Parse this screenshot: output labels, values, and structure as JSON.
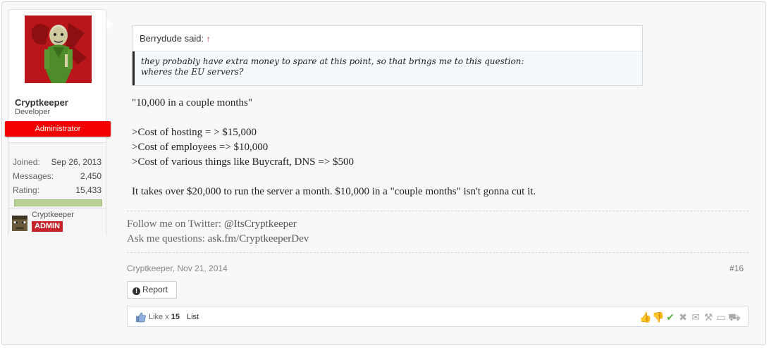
{
  "user": {
    "name": "Cryptkeeper",
    "title": "Developer",
    "banner": "Administrator",
    "joined_label": "Joined:",
    "joined_value": "Sep 26, 2013",
    "messages_label": "Messages:",
    "messages_value": "2,450",
    "rating_label": "Rating:",
    "rating_value": "15,433",
    "rating_bar_fraction": 1.0,
    "secondary_name": "Cryptkeeper",
    "badge": "ADMIN"
  },
  "quote": {
    "author": "Berrydude said:",
    "arrow": "↑",
    "line1": "they probably have extra money to spare at this point, so that brings me to this question:",
    "line2": "wheres the EU servers?"
  },
  "message": {
    "line1": "\"10,000 in a couple months\"",
    "line2": ">Cost of hosting = > $15,000",
    "line3": ">Cost of employees => $10,000",
    "line4": ">Cost of various things like Buycraft, DNS => $500",
    "line5": "It takes over $20,000 to run the server a month. $10,000 in a \"couple months\" isn't gonna cut it."
  },
  "signature": {
    "line1_prefix": "Follow me on Twitter: ",
    "line1_handle": "@ItsCryptkeeper",
    "line2_prefix": "Ask me questions: ",
    "line2_link": "ask.fm/CryptkeeperDev"
  },
  "meta": {
    "author_date": "Cryptkeeper, Nov 21, 2014",
    "post_number": "#16"
  },
  "actions": {
    "report_label": "Report",
    "like_text": "Like x ",
    "like_count": "15",
    "list_label": "List"
  },
  "colors": {
    "banner": "#f30000",
    "admin_badge": "#c5242b",
    "rating_bar": "#b6d193"
  }
}
